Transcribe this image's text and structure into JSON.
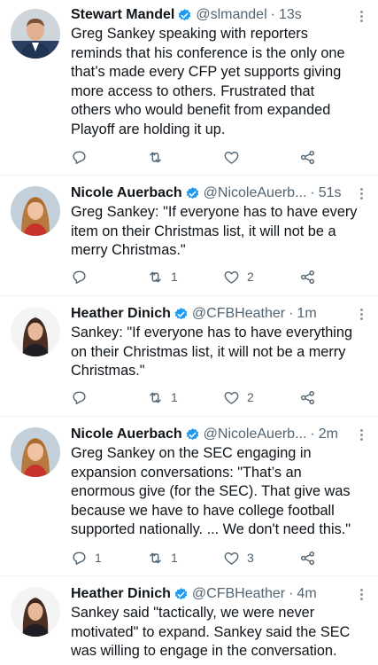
{
  "tweets": [
    {
      "name": "Stewart Mandel",
      "handle": "@slmandel",
      "sep": "·",
      "time": "13s",
      "lines": [
        "Greg Sankey speaking with reporters",
        "reminds that his conference is the only one",
        "that’s made every CFP yet supports giving",
        "more access to others. Frustrated that",
        "others who would benefit from expanded",
        "Playoff are holding it up."
      ],
      "replies": "",
      "retweets": "",
      "likes": ""
    },
    {
      "name": "Nicole Auerbach",
      "handle": "@NicoleAuerb...",
      "sep": "·",
      "time": "51s",
      "lines": [
        "Greg Sankey: \"If everyone has to have every",
        "item on their Christmas list, it will not be a",
        "merry Christmas.\""
      ],
      "replies": "",
      "retweets": "1",
      "likes": "2"
    },
    {
      "name": "Heather Dinich",
      "handle": "@CFBHeather",
      "sep": "·",
      "time": "1m",
      "lines": [
        "Sankey: \"If everyone has to have everything",
        "on their Christmas list, it will not be a merry",
        "Christmas.\""
      ],
      "replies": "",
      "retweets": "1",
      "likes": "2"
    },
    {
      "name": "Nicole Auerbach",
      "handle": "@NicoleAuerb...",
      "sep": "·",
      "time": "2m",
      "lines": [
        "Greg Sankey on the SEC engaging in",
        "expansion conversations: \"That’s an",
        "enormous give (for the SEC). That give was",
        "because we have to have college football",
        "supported nationally. ... We don't need this.\""
      ],
      "replies": "1",
      "retweets": "1",
      "likes": "3"
    },
    {
      "name": "Heather Dinich",
      "handle": "@CFBHeather",
      "sep": "·",
      "time": "4m",
      "lines": [
        "Sankey said \"tactically, we were never",
        "motivated\" to expand. Sankey said the SEC",
        "was willing to engage in the conversation."
      ],
      "replies": "",
      "retweets": "",
      "likes": ""
    }
  ],
  "icons": {
    "verified": "verified-badge-icon",
    "reply": "reply-icon",
    "retweet": "retweet-icon",
    "like": "heart-icon",
    "share": "share-icon",
    "more": "more-icon"
  },
  "colors": {
    "verified": "#1d9bf0",
    "secondary_text": "#536471",
    "divider": "#eff3f4"
  }
}
